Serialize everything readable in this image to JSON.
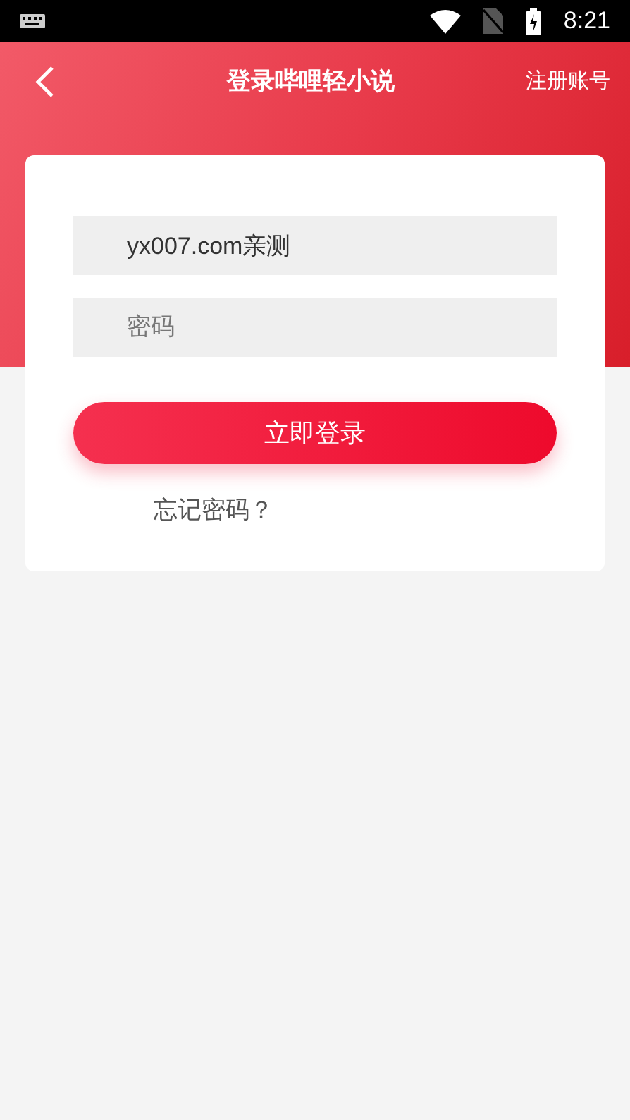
{
  "status_bar": {
    "time": "8:21"
  },
  "header": {
    "title": "登录哔哩轻小说",
    "action": "注册账号"
  },
  "form": {
    "username": {
      "value": "yx007.com亲测"
    },
    "password": {
      "placeholder": "密码"
    },
    "submit": "立即登录",
    "forgot": "忘记密码？"
  }
}
